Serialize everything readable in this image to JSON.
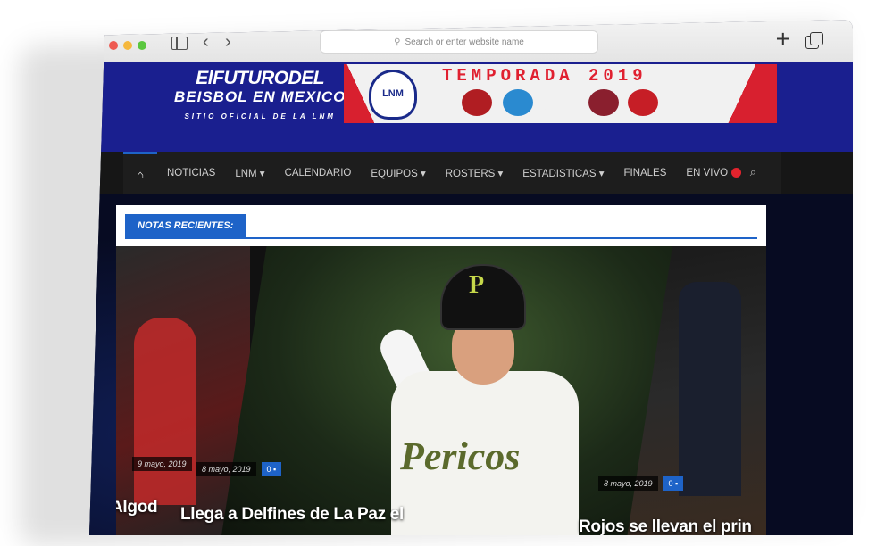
{
  "browser": {
    "url_placeholder": "Search or enter website name",
    "plus_glyph": "+",
    "back_glyph": "‹",
    "forward_glyph": "›"
  },
  "site": {
    "logo_line1": "ElFUTURODEL",
    "logo_line2": "BEISBOL EN MEXICO",
    "logo_line3": "SITIO OFICIAL DE LA LNM",
    "banner_title": "TEMPORADA 2019",
    "banner_badge": "LNM"
  },
  "nav": {
    "home_glyph": "⌂",
    "items": [
      {
        "label": "NOTICIAS"
      },
      {
        "label": "LNM ▾"
      },
      {
        "label": "CALENDARIO"
      },
      {
        "label": "EQUIPOS ▾"
      },
      {
        "label": "ROSTERS ▾"
      },
      {
        "label": "ESTADISTICAS ▾"
      },
      {
        "label": "FINALES"
      },
      {
        "label": "EN VIVO"
      }
    ],
    "search_glyph": "⌕"
  },
  "section": {
    "title": "NOTAS RECIENTES:"
  },
  "articles": [
    {
      "date": "9 mayo, 2019",
      "headline": "Algod"
    },
    {
      "date": "8 mayo, 2019",
      "comments": "0 ▪",
      "headline": "Llega a Delfines de La Paz el"
    },
    {
      "date": "8 mayo, 2019",
      "comments": "0 ▪",
      "headline": "Rojos se llevan el prin"
    }
  ],
  "photo": {
    "jersey_text": "Pericos",
    "helmet_letter": "P"
  },
  "colors": {
    "header_blue": "#1a1f8f",
    "accent_blue": "#1e63c8",
    "live_red": "#e3232d",
    "nav_bg": "#1d1d1d"
  }
}
